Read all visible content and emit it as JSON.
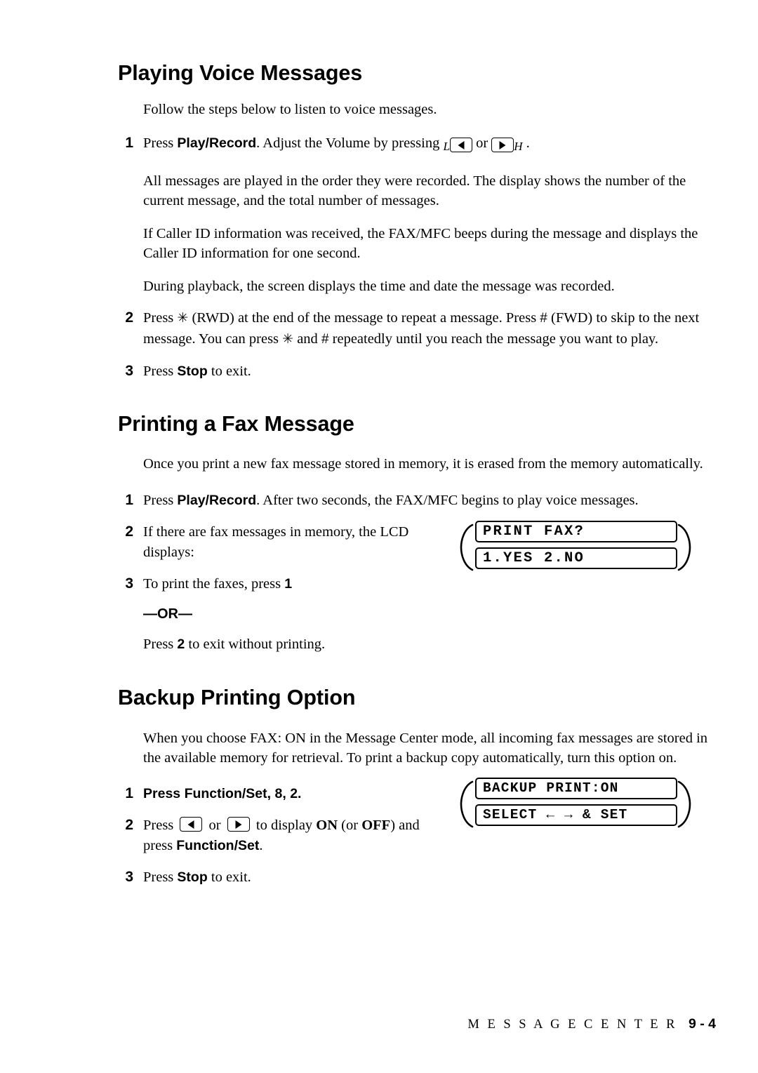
{
  "document": {
    "footer_label": "M E S S A G E   C E N T E R",
    "page_number": "9 - 4"
  },
  "sections": [
    {
      "id": "playing-voice-messages",
      "title": "Playing Voice Messages",
      "intro": "Follow the steps below to listen to voice messages.",
      "steps": [
        {
          "num": "1",
          "pre": "Press ",
          "bold": "Play/Record",
          "post": ". Adjust the Volume by pressing ",
          "tail": " or ",
          "end": " ."
        },
        {
          "num": "2",
          "text_a": "Press ",
          "text_b": " (RWD) at the end of the message to repeat a message. Press ",
          "text_c": " (FWD) to skip to the next message. You can press ",
          "text_d": " and ",
          "text_e": " repeatedly until you reach the message you want to play."
        },
        {
          "num": "3",
          "pre": "Press ",
          "bold": "Stop",
          "post": " to exit."
        }
      ],
      "paragraphs": [
        "All messages are played in the order they were recorded. The display shows the number of the current message, and the total number of messages.",
        "If Caller ID information was received, the FAX/MFC beeps during the message and displays the Caller ID information for one second.",
        "During playback, the screen displays the time and date the message was recorded."
      ]
    },
    {
      "id": "printing-a-fax-message",
      "title": "Printing a Fax Message",
      "intro": "Once you print a new fax message stored in memory, it is erased from the memory automatically.",
      "steps": [
        {
          "num": "1",
          "pre": "Press ",
          "bold": "Play/Record",
          "post": ". After two seconds, the FAX/MFC begins to play voice messages."
        },
        {
          "num": "2",
          "text": "If there are fax messages in memory, the LCD displays:"
        },
        {
          "num": "3",
          "pre": "To print the faxes, press ",
          "bold": "1"
        }
      ],
      "or_label": "—OR—",
      "or_text_pre": "Press ",
      "or_text_bold": "2",
      "or_text_post": " to exit without printing.",
      "lcd": {
        "line1": "PRINT FAX?",
        "line2": "1.YES 2.NO"
      }
    },
    {
      "id": "backup-printing-option",
      "title": "Backup Printing Option",
      "intro": "When you choose FAX: ON in the Message Center mode, all incoming fax messages are stored in the available memory for retrieval. To print a backup copy automatically, turn this option on.",
      "steps": [
        {
          "num": "1",
          "pre": "Press ",
          "bold": "Function/Set",
          "mid": ", ",
          "bold2": "8",
          "mid2": ", ",
          "bold3": "2",
          "post": "."
        },
        {
          "num": "2",
          "pre": "Press ",
          "mid": " or ",
          "post": " to display ",
          "bold_on": "ON",
          "post2": " (or ",
          "bold_off": "OFF",
          "post3": ") and press ",
          "bold_fn": "Function/Set",
          "post4": "."
        },
        {
          "num": "3",
          "pre": "Press ",
          "bold": "Stop",
          "post": " to exit."
        }
      ],
      "lcd": {
        "line1": "BACKUP PRINT:ON",
        "line2": "SELECT ← → & SET"
      }
    }
  ],
  "icons": {
    "volume_down": "volume-down-key-icon",
    "volume_up": "volume-up-key-icon",
    "rwd": "✳",
    "fwd": "#",
    "left_arrow_key": "left-arrow-key-icon",
    "right_arrow_key": "right-arrow-key-icon"
  },
  "colors": {
    "text": "#000000",
    "background": "#ffffff"
  }
}
